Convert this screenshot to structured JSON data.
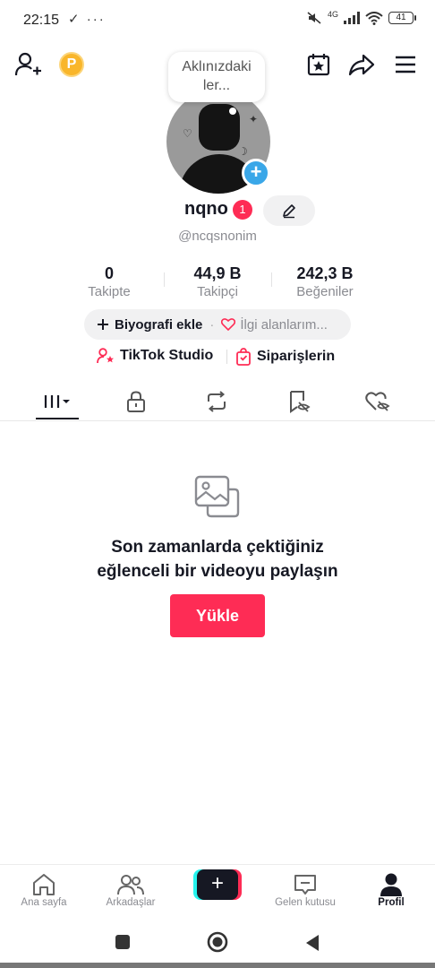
{
  "status_bar": {
    "time": "22:15",
    "left_icons": "✓ ···",
    "signal": "4G",
    "battery": "41"
  },
  "thought_bubble": {
    "line1": "Aklınızdaki",
    "line2": "ler..."
  },
  "profile": {
    "username": "nqno",
    "badge_count": "1",
    "handle": "@ncqsnonim"
  },
  "stats": [
    {
      "value": "0",
      "label": "Takipte"
    },
    {
      "value": "44,9 B",
      "label": "Takipçi"
    },
    {
      "value": "242,3 B",
      "label": "Beğeniler"
    }
  ],
  "bio": {
    "add_label": "Biyografi ekle",
    "separator": "·",
    "interests_label": "İlgi alanlarım..."
  },
  "links": {
    "studio_label": "TikTok Studio",
    "orders_label": "Siparişlerin"
  },
  "empty_state": {
    "line1": "Son zamanlarda çektiğiniz",
    "line2": "eğlenceli bir videoyu paylaşın",
    "upload_label": "Yükle"
  },
  "bottom_nav": {
    "home": "Ana sayfa",
    "friends": "Arkadaşlar",
    "inbox": "Gelen kutusu",
    "profile": "Profil"
  },
  "colors": {
    "accent": "#fe2c55",
    "teal": "#25f4ee",
    "text": "#161823",
    "muted": "#8a8b91"
  }
}
